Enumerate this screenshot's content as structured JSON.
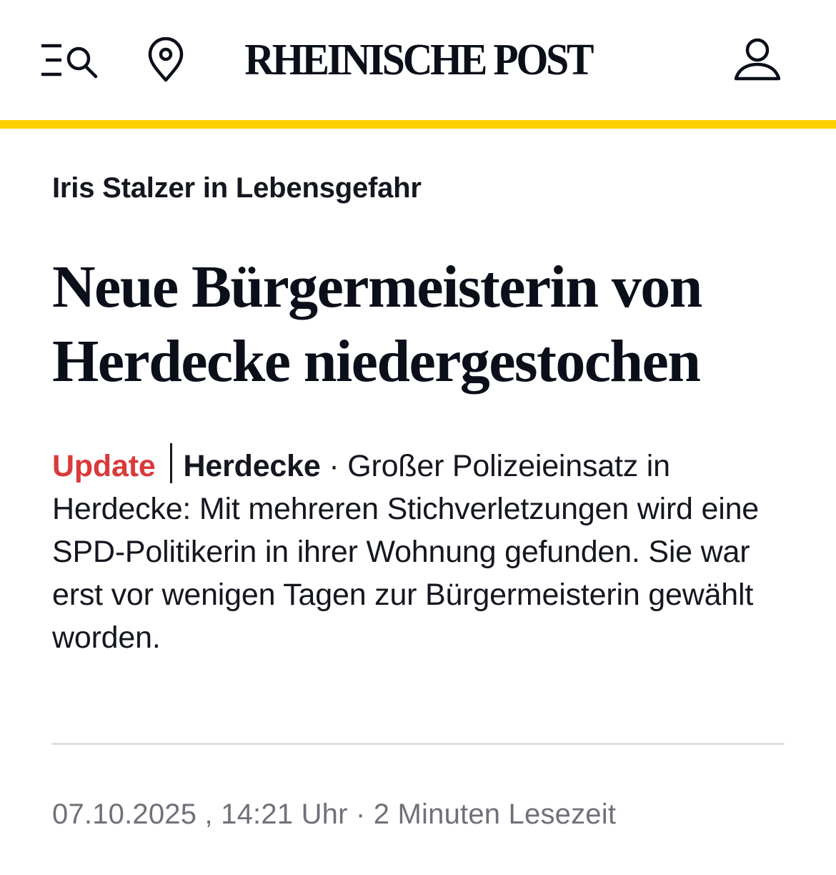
{
  "header": {
    "logo_text": "RHEINISCHE POST",
    "accent_color": "#ffd000",
    "icons": {
      "menu_search": "menu-search-icon",
      "location": "location-pin-icon",
      "account": "user-icon"
    }
  },
  "article": {
    "kicker": "Iris Stalzer in Lebensgefahr",
    "headline": "Neue Bürgermeisterin von Herdecke niedergestochen",
    "teaser": {
      "label": "Update",
      "label_color": "#d93a3a",
      "location": "Herdecke",
      "separator": " · ",
      "text": "Großer Polizeieinsatz in Herdecke: Mit mehreren Stichverletzungen wird eine SPD-Politikerin in ihrer Wohnung gefunden. Sie war erst vor wenigen Tagen zur Bürgermeisterin gewählt worden."
    },
    "meta": {
      "date": "07.10.2025",
      "time": "14:21 Uhr",
      "read_time": "2 Minuten Lesezeit"
    }
  }
}
